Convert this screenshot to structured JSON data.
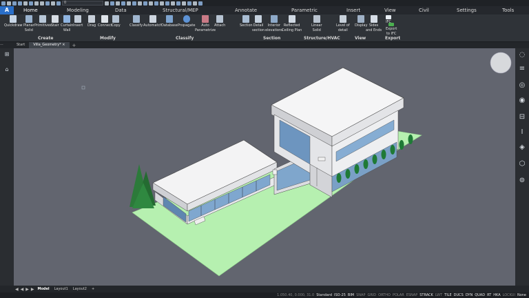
{
  "qat": {
    "layer_name": "0"
  },
  "tabs": {
    "app_button": "A",
    "items": [
      "Home",
      "Modeling",
      "Data",
      "Structural/MEP",
      "Annotate",
      "Parametric",
      "Insert",
      "View",
      "Civil",
      "Settings",
      "Tools"
    ]
  },
  "ribbon": {
    "create": {
      "label": "Create",
      "buttons": [
        {
          "l1": "Quickdraw",
          "l2": ""
        },
        {
          "l1": "Planar",
          "l2": "Solid"
        },
        {
          "l1": "Primitives",
          "l2": ""
        },
        {
          "l1": "Stair",
          "l2": ""
        },
        {
          "l1": "Curtain",
          "l2": "Wall"
        },
        {
          "l1": "Insert",
          "l2": ""
        }
      ]
    },
    "modify": {
      "label": "Modify",
      "buttons": [
        {
          "l1": "Drag",
          "l2": ""
        },
        {
          "l1": "Connect",
          "l2": ""
        },
        {
          "l1": "Copy",
          "l2": ""
        }
      ]
    },
    "classify": {
      "label": "Classify",
      "buttons": [
        {
          "l1": "Classify",
          "l2": ""
        },
        {
          "l1": "Automatch",
          "l2": ""
        },
        {
          "l1": "Database",
          "l2": ""
        },
        {
          "l1": "Propagate",
          "l2": ""
        },
        {
          "l1": "Auto",
          "l2": "Parametrize"
        },
        {
          "l1": "Attach",
          "l2": ""
        }
      ]
    },
    "section": {
      "label": "Section",
      "buttons": [
        {
          "l1": "Section",
          "l2": ""
        },
        {
          "l1": "Detail",
          "l2": "section"
        },
        {
          "l1": "Interior",
          "l2": "elevations"
        },
        {
          "l1": "Reflected",
          "l2": "Ceiling Plan"
        }
      ]
    },
    "structure": {
      "label": "Structure/HVAC",
      "buttons": [
        {
          "l1": "Linear",
          "l2": "Solid"
        }
      ]
    },
    "view": {
      "label": "View",
      "buttons": [
        {
          "l1": "Level of",
          "l2": "detail"
        },
        {
          "l1": "Display",
          "l2": ""
        },
        {
          "l1": "Sides",
          "l2": "and Ends"
        }
      ]
    },
    "export": {
      "label": "Export",
      "buttons": [
        {
          "l1": "IFC",
          "l2": ""
        },
        {
          "l1": "Export",
          "l2": "to IFC"
        }
      ]
    }
  },
  "doc_tabs": {
    "start": "Start",
    "active": "Villa_Geometry*",
    "close": "×",
    "plus": "+"
  },
  "layout_tabs": {
    "items": [
      "Model",
      "Layout1",
      "Layout2"
    ],
    "plus": "+",
    "arrows": [
      "◀",
      "◀",
      "▶",
      "▶"
    ]
  },
  "status": {
    "items": [
      {
        "t": "1.050.40, 0.000, 31.0",
        "on": false
      },
      {
        "t": "Standard",
        "on": true
      },
      {
        "t": "ISO-25",
        "on": true
      },
      {
        "t": "BIM",
        "on": true
      },
      {
        "t": "SNAP",
        "on": false
      },
      {
        "t": "GRID",
        "on": false
      },
      {
        "t": "ORTHO",
        "on": false
      },
      {
        "t": "POLAR",
        "on": false
      },
      {
        "t": "ESNAP",
        "on": false
      },
      {
        "t": "STRACK",
        "on": true
      },
      {
        "t": "LWT",
        "on": false
      },
      {
        "t": "TILE",
        "on": true
      },
      {
        "t": "DUCS",
        "on": true
      },
      {
        "t": "DYN",
        "on": true
      },
      {
        "t": "QUAD",
        "on": true
      },
      {
        "t": "RT",
        "on": true
      },
      {
        "t": "HKA",
        "on": true
      },
      {
        "t": "LOCKUI",
        "on": false
      },
      {
        "t": "None",
        "on": true
      }
    ]
  },
  "colors": {
    "viewport_bg": "#62656f",
    "lawn": "#b6f0b0",
    "tree": "#2c7a3a",
    "ribbon_bg": "#2f3338",
    "accent": "#2a6fc9"
  }
}
